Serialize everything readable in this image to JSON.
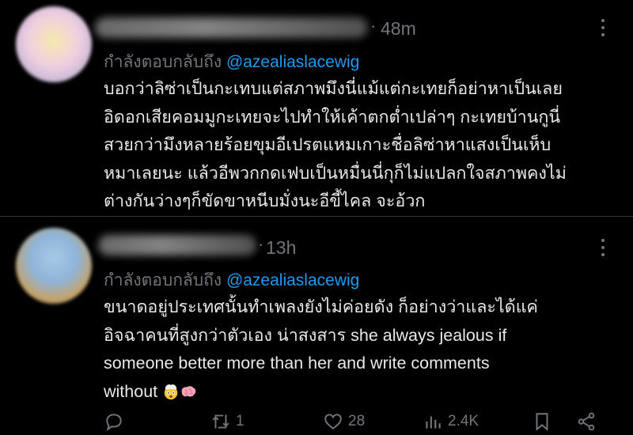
{
  "tweets": [
    {
      "time": "48m",
      "replying_prefix": "กำลังตอบกลับถึง ",
      "replying_handle": "@azealiaslacewig",
      "lines": [
        "บอกว่าลิซ่าเป็นกะเทบแต่สภาพมึงนี่แม้แต่กะเทยก็อย่าหาเป็นเลย",
        "อิดอกเสียคอมมูกะเทยจะไปทำให้เค้าตกต่ำเปล่าๆ กะเทยบ้านกูนี่",
        "สวยกว่ามึงหลายร้อยขุมอีเปรตแหมเกาะชื่อลิซ่าหาแสงเป็นเห็บ",
        "หมาเลยนะ แล้วอีพวกกดเฟบเป็นหมื่นนี่กุก็ไม่แปลกใจสภาพคงไม่",
        "ต่างกันว่างๆก็ขัดขาหนีบมั่งนะอีขี้ไคล จะอ้วก"
      ]
    },
    {
      "time": "13h",
      "replying_prefix": "กำลังตอบกลับถึง ",
      "replying_handle": "@azealiaslacewig",
      "lines": [
        "ขนาดอยู่ประเทศนั้นทำเพลงยังไม่ค่อยดัง ก็อย่างว่าและได้แค่",
        "อิจฉาคนที่สูงกว่าตัวเอง น่าสงสาร she always jealous if",
        "someone better more than her and write comments",
        "without"
      ],
      "emojis": [
        "exploding-head",
        "brain"
      ],
      "stats": {
        "retweets": "1",
        "likes": "28",
        "views": "2.4K"
      }
    }
  ],
  "colors": {
    "background": "#000000",
    "text": "#e7e9ea",
    "muted": "#71767b",
    "link": "#1d9bf0",
    "divider": "#2f3336"
  }
}
